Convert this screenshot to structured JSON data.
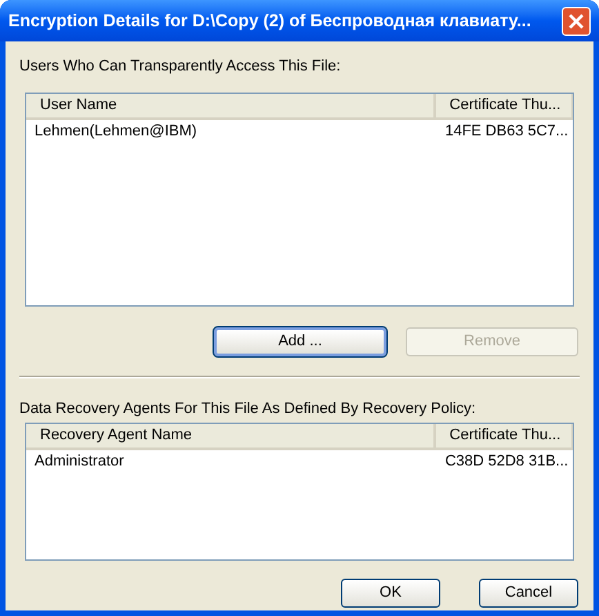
{
  "window": {
    "title": "Encryption Details for D:\\Copy (2) of Беспроводная клавиату..."
  },
  "users": {
    "label": "Users Who Can Transparently Access This File:",
    "columns": [
      "User Name",
      "Certificate Thu..."
    ],
    "rows": [
      [
        "Lehmen(Lehmen@IBM)",
        "14FE DB63 5C7..."
      ]
    ]
  },
  "user_buttons": [
    {
      "label": "Add ...",
      "disabled": false,
      "focused": true
    },
    {
      "label": "Remove",
      "disabled": true,
      "focused": false
    }
  ],
  "agents": {
    "label": "Data Recovery Agents For This File As Defined By Recovery Policy:",
    "columns": [
      "Recovery Agent Name",
      "Certificate Thu..."
    ],
    "rows": [
      [
        "Administrator",
        "C38D 52D8 31B..."
      ]
    ]
  },
  "buttons": [
    {
      "label": "OK",
      "disabled": false,
      "focused": false
    },
    {
      "label": "Cancel",
      "disabled": false,
      "focused": false
    }
  ]
}
